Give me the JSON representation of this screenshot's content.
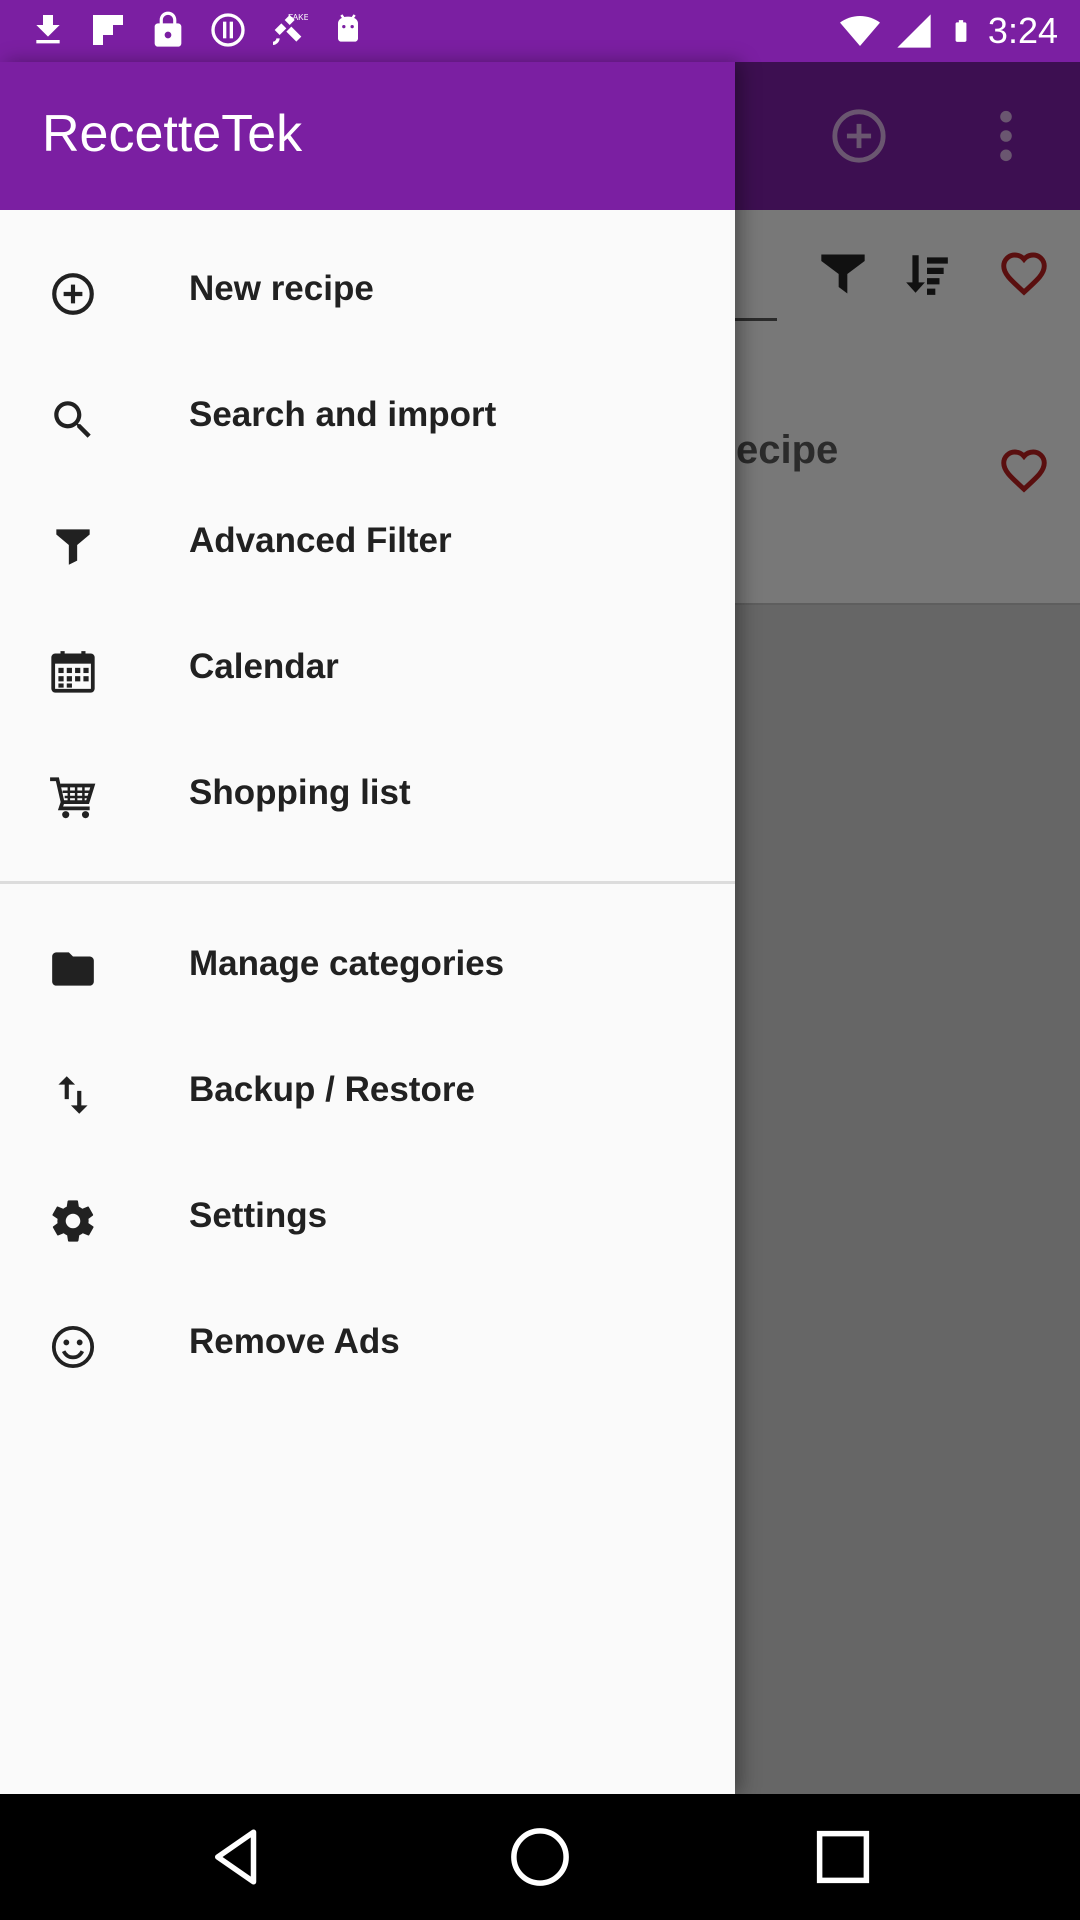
{
  "status_bar": {
    "time": "3:24",
    "icons": [
      "download-icon",
      "flipboard-icon",
      "lock-icon",
      "info-icon",
      "satellite-icon",
      "android-icon",
      "wifi-icon",
      "signal-icon",
      "battery-icon"
    ]
  },
  "app": {
    "name": "RecetteTek",
    "background_recipe_text": "ecipe"
  },
  "drawer": {
    "items": [
      {
        "label": "New recipe",
        "icon": "add-circle-icon"
      },
      {
        "label": "Search and import",
        "icon": "search-icon"
      },
      {
        "label": "Advanced Filter",
        "icon": "filter-icon"
      },
      {
        "label": "Calendar",
        "icon": "calendar-icon"
      },
      {
        "label": "Shopping list",
        "icon": "cart-icon"
      },
      {
        "label": "Manage categories",
        "icon": "folder-icon"
      },
      {
        "label": "Backup / Restore",
        "icon": "swap-vertical-icon"
      },
      {
        "label": "Settings",
        "icon": "gear-icon"
      },
      {
        "label": "Remove Ads",
        "icon": "smiley-icon"
      }
    ]
  },
  "colors": {
    "primary": "#7b1fa2",
    "primary_dimmed": "#3d0f51",
    "scrim": "#666666",
    "drawer_bg": "#fafafa",
    "heart": "#5a0f0f"
  }
}
